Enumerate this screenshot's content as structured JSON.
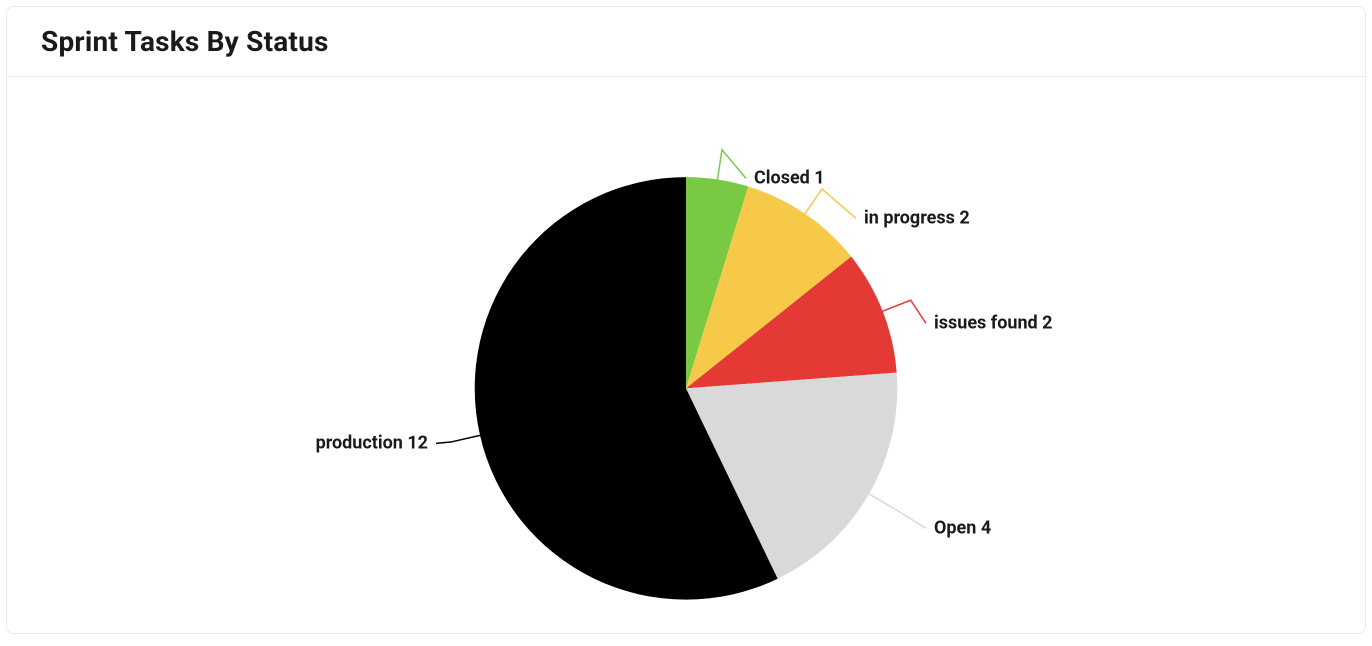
{
  "card": {
    "title": "Sprint Tasks By Status"
  },
  "chart_data": {
    "type": "pie",
    "title": "Sprint Tasks By Status",
    "series": [
      {
        "name": "Closed",
        "value": 1,
        "color": "#7ac943"
      },
      {
        "name": "in progress",
        "value": 2,
        "color": "#f7c948"
      },
      {
        "name": "issues found",
        "value": 2,
        "color": "#e53935"
      },
      {
        "name": "Open",
        "value": 4,
        "color": "#d9d9d9"
      },
      {
        "name": "production",
        "value": 12,
        "color": "#000000"
      }
    ]
  }
}
